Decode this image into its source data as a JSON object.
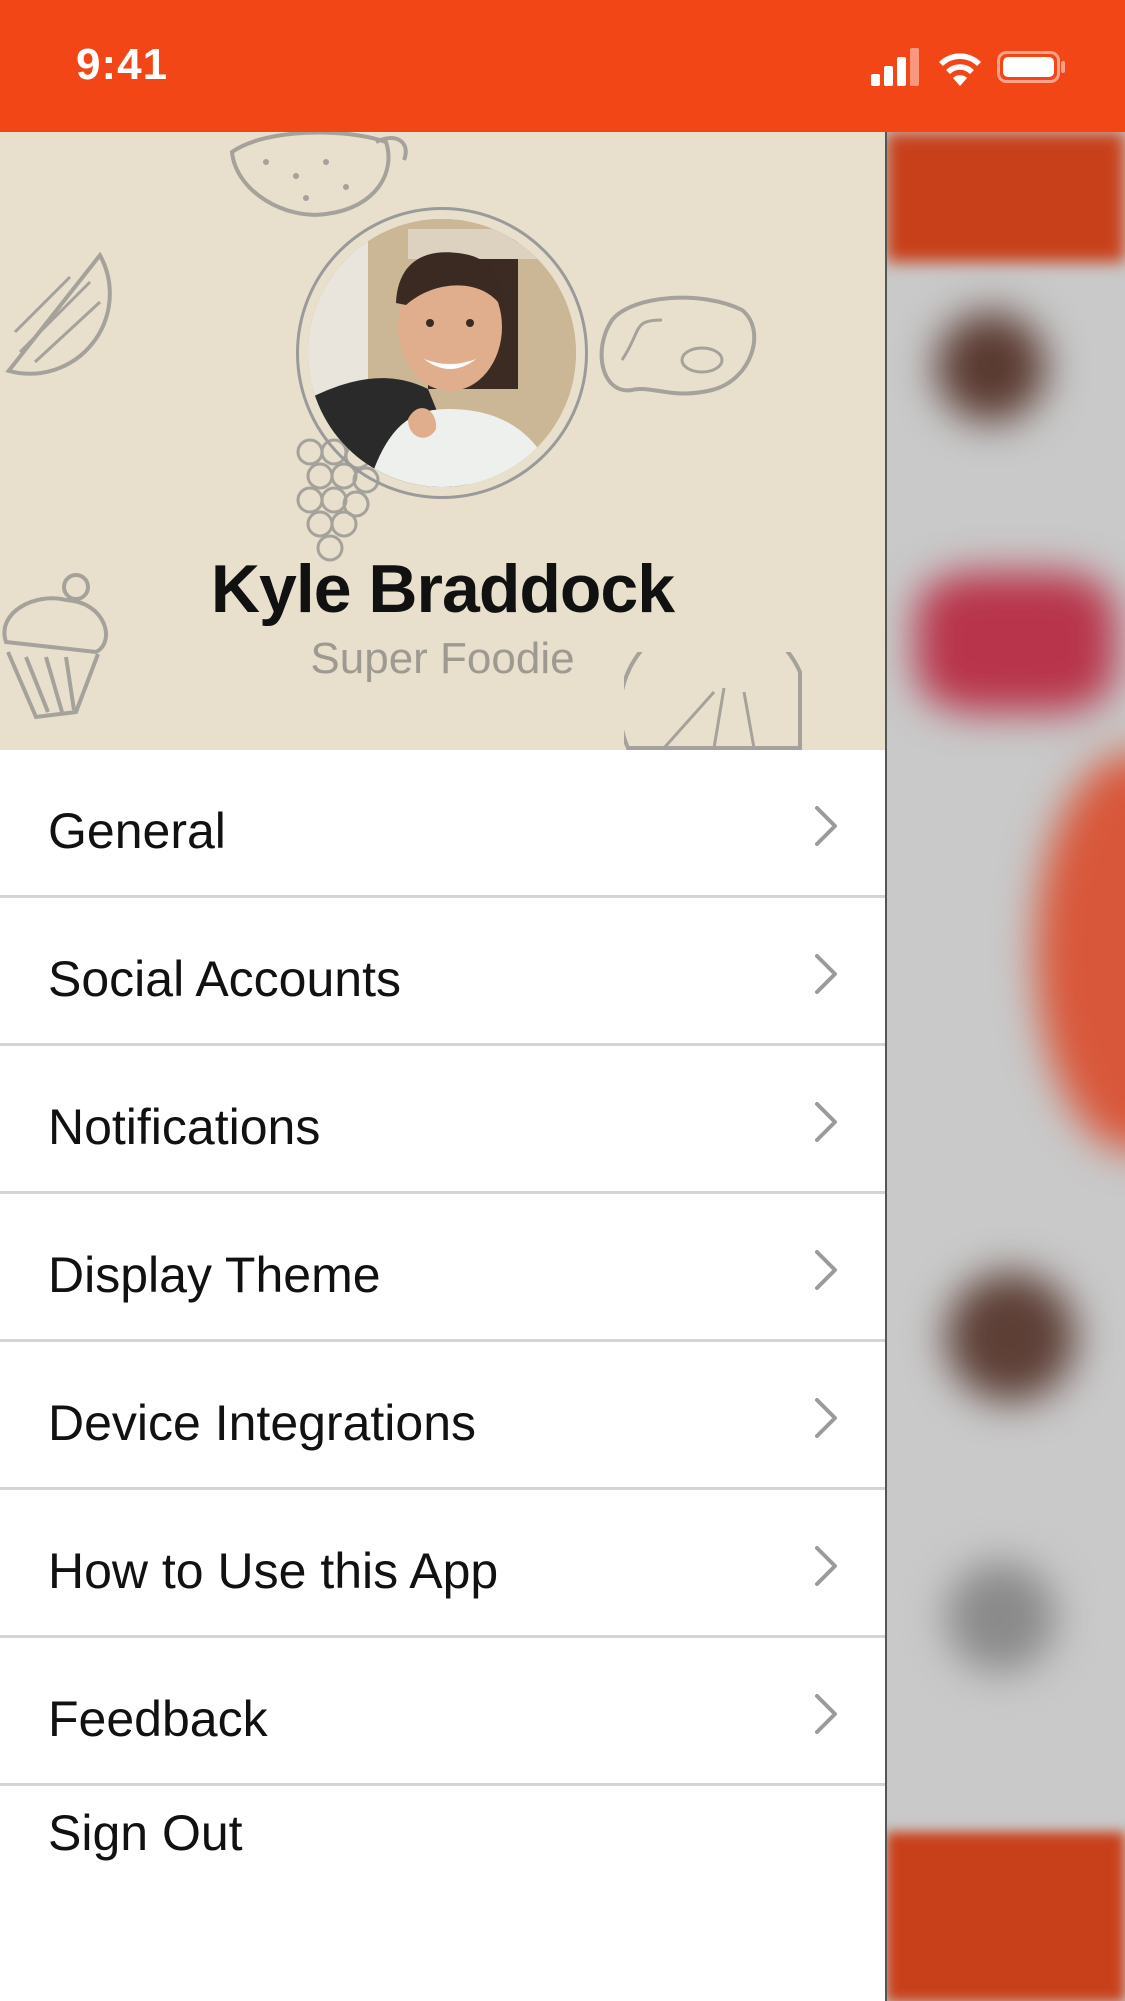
{
  "status_bar": {
    "time": "9:41",
    "icons": [
      "cellular-signal-icon",
      "wifi-icon",
      "battery-icon"
    ],
    "background_color": "#F24616"
  },
  "profile": {
    "name": "Kyle Braddock",
    "subtitle": "Super Foodie",
    "header_color": "#E8E0CC"
  },
  "menu": {
    "items": [
      {
        "label": "General"
      },
      {
        "label": "Social Accounts"
      },
      {
        "label": "Notifications"
      },
      {
        "label": "Display Theme"
      },
      {
        "label": "Device Integrations"
      },
      {
        "label": "How to Use this App"
      },
      {
        "label": "Feedback"
      }
    ],
    "sign_out": "Sign Out"
  },
  "colors": {
    "accent": "#F24616",
    "chevron": "#9b9b9b",
    "divider": "#d4d4d4"
  }
}
